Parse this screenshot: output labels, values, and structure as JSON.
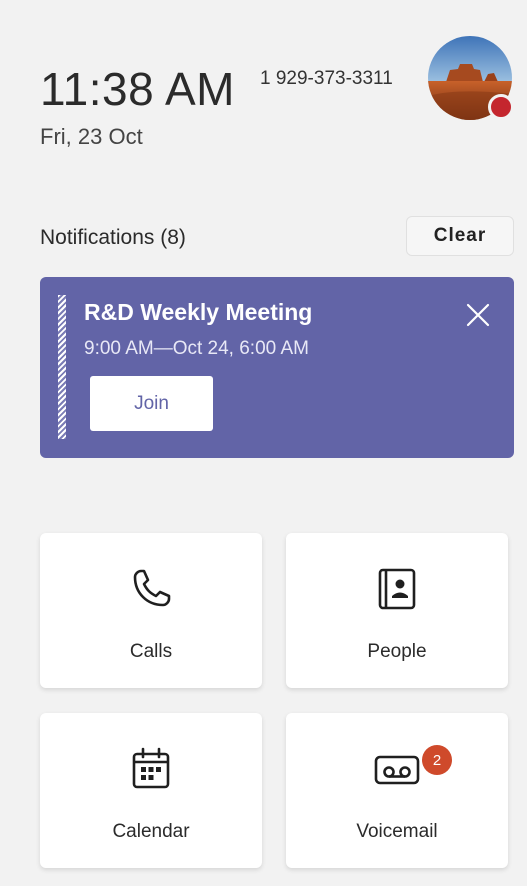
{
  "header": {
    "time": "11:38 AM",
    "date": "Fri, 23 Oct",
    "phone_number": "1 929-373-3311",
    "status_color": "#c4262e"
  },
  "notifications": {
    "title": "Notifications (8)",
    "clear_label": "Clear"
  },
  "meeting": {
    "title": "R&D Weekly Meeting",
    "time": "9:00 AM—Oct 24, 6:00 AM",
    "join_label": "Join",
    "accent_color": "#6264a7"
  },
  "tiles": [
    {
      "label": "Calls",
      "icon": "phone-icon"
    },
    {
      "label": "People",
      "icon": "contact-book-icon"
    },
    {
      "label": "Calendar",
      "icon": "calendar-icon"
    },
    {
      "label": "Voicemail",
      "icon": "voicemail-icon",
      "badge": "2"
    }
  ]
}
